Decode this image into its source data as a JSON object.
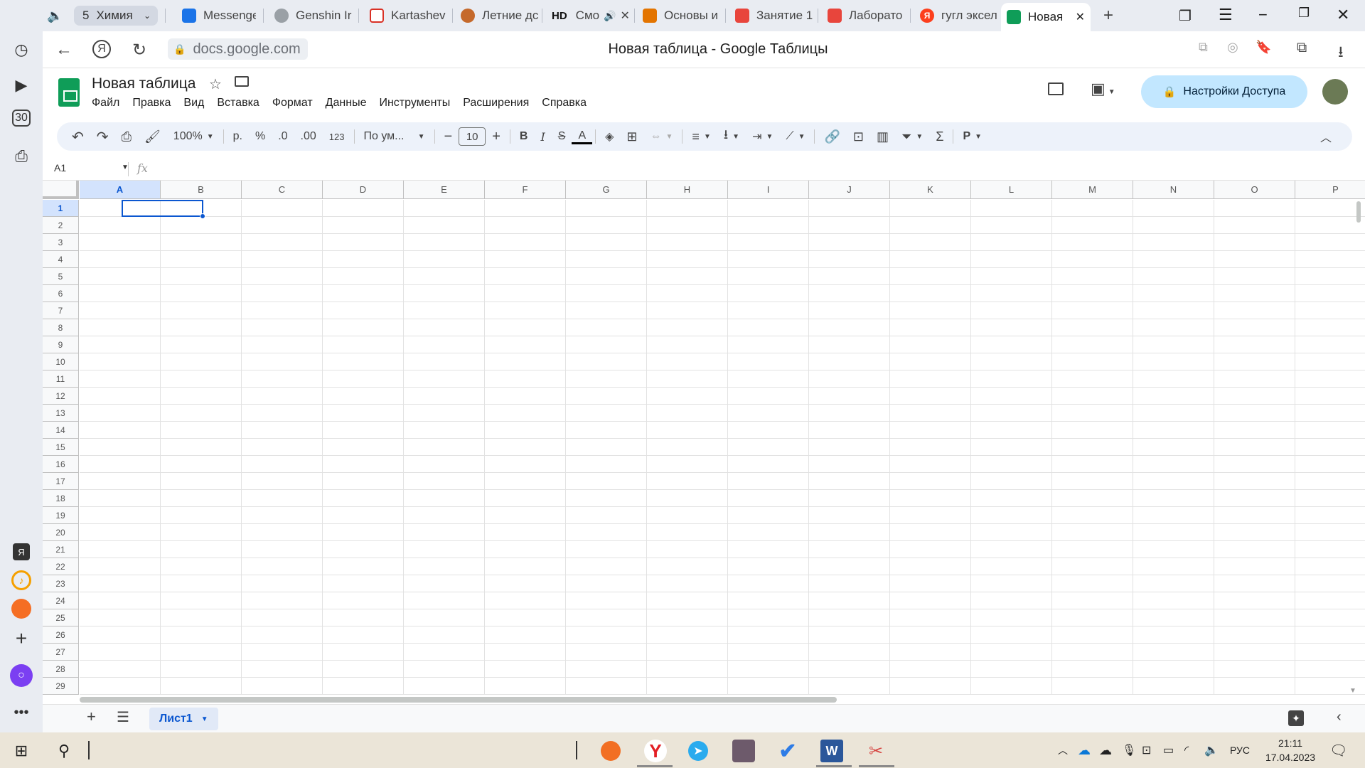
{
  "browser": {
    "tab_group_count": "5",
    "tab_group_name": "Химия",
    "tabs": [
      {
        "label": "Messenge",
        "color": "#1a73e8"
      },
      {
        "label": "Genshin Ir",
        "color": "#9aa0a6"
      },
      {
        "label": "Kartashev",
        "color": "#d93025"
      },
      {
        "label": "Летние дс",
        "color": "#c5692b"
      },
      {
        "label": "Смо",
        "prefix": "HD",
        "color": "#111111"
      },
      {
        "label": "Основы и",
        "color": "#e37400"
      },
      {
        "label": "Занятие 1",
        "color": "#e8453c"
      },
      {
        "label": "Лаборато",
        "color": "#e8453c"
      },
      {
        "label": "гугл эксел",
        "color": "#fc3f1d"
      },
      {
        "label": "Новая",
        "color": "#0f9d58",
        "active": true
      }
    ],
    "url": "docs.google.com",
    "page_title": "Новая таблица - Google Таблицы",
    "rail_badge": "30"
  },
  "docs": {
    "title": "Новая таблица",
    "menu": [
      "Файл",
      "Правка",
      "Вид",
      "Вставка",
      "Формат",
      "Данные",
      "Инструменты",
      "Расширения",
      "Справка"
    ],
    "share_label": "Настройки Доступа",
    "accent": "#0b57d0",
    "share_bg": "#c2e7ff"
  },
  "toolbar": {
    "zoom": "100%",
    "currency": "р.",
    "percent": "%",
    "dec_less": ".0",
    "dec_more": ".00",
    "format_123": "123",
    "font": "По ум...",
    "font_size": "10",
    "bold": "B",
    "italic": "I",
    "strike": "S",
    "text_color": "A"
  },
  "formula": {
    "cell_ref": "A1",
    "fx": "fx"
  },
  "grid": {
    "columns": [
      "A",
      "B",
      "C",
      "D",
      "E",
      "F",
      "G",
      "H",
      "I",
      "J",
      "K",
      "L",
      "M",
      "N",
      "O",
      "P"
    ],
    "rows": [
      "1",
      "2",
      "3",
      "4",
      "5",
      "6",
      "7",
      "8",
      "9",
      "10",
      "11",
      "12",
      "13",
      "14",
      "15",
      "16",
      "17",
      "18",
      "19",
      "20",
      "21",
      "22",
      "23",
      "24",
      "25",
      "26",
      "27",
      "28",
      "29"
    ],
    "selected_cell": "A1"
  },
  "sheets": {
    "active": "Лист1"
  },
  "taskbar": {
    "lang": "РУС",
    "time": "21:11",
    "date": "17.04.2023"
  }
}
